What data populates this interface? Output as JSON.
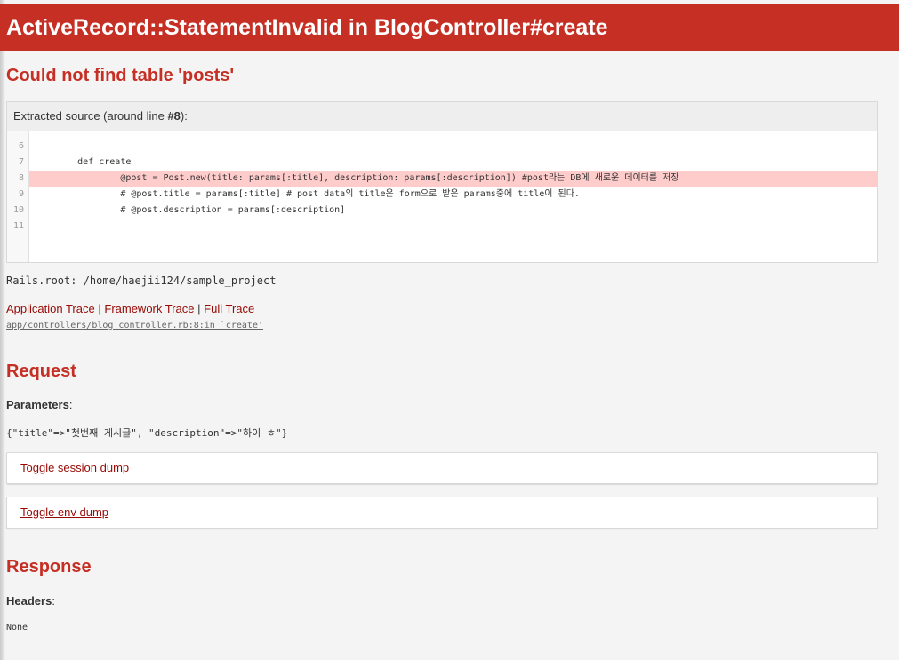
{
  "header": {
    "title": "ActiveRecord::StatementInvalid in BlogController#create"
  },
  "error": {
    "message": "Could not find table 'posts'"
  },
  "source": {
    "title_prefix": "Extracted source (around line ",
    "title_line": "#8",
    "title_suffix": "):",
    "lines": [
      {
        "num": "6",
        "code": ""
      },
      {
        "num": "7",
        "code": "        def create"
      },
      {
        "num": "8",
        "code": "                @post = Post.new(title: params[:title], description: params[:description]) #post라는 DB에 새로운 데이터를 저장"
      },
      {
        "num": "9",
        "code": "                # @post.title = params[:title] # post data의 title은 form으로 받은 params중에 title이 된다."
      },
      {
        "num": "10",
        "code": "                # @post.description = params[:description]"
      },
      {
        "num": "11",
        "code": ""
      }
    ],
    "highlight_line": "8"
  },
  "rails_root": "Rails.root: /home/haejii124/sample_project",
  "traces": {
    "application": "Application Trace",
    "framework": "Framework Trace",
    "full": "Full Trace",
    "separator": "|",
    "first_line": "app/controllers/blog_controller.rb:8:in `create'"
  },
  "request": {
    "heading": "Request",
    "parameters_label": "Parameters",
    "parameters_value": "{\"title\"=>\"첫번째 게시글\", \"description\"=>\"하이 ㅎ\"}",
    "toggle_session": "Toggle session dump",
    "toggle_env": "Toggle env dump"
  },
  "response": {
    "heading": "Response",
    "headers_label": "Headers",
    "headers_value": "None"
  },
  "colors": {
    "brand_red": "#c52f24",
    "link": "#980905",
    "highlight": "#ffcccc"
  }
}
